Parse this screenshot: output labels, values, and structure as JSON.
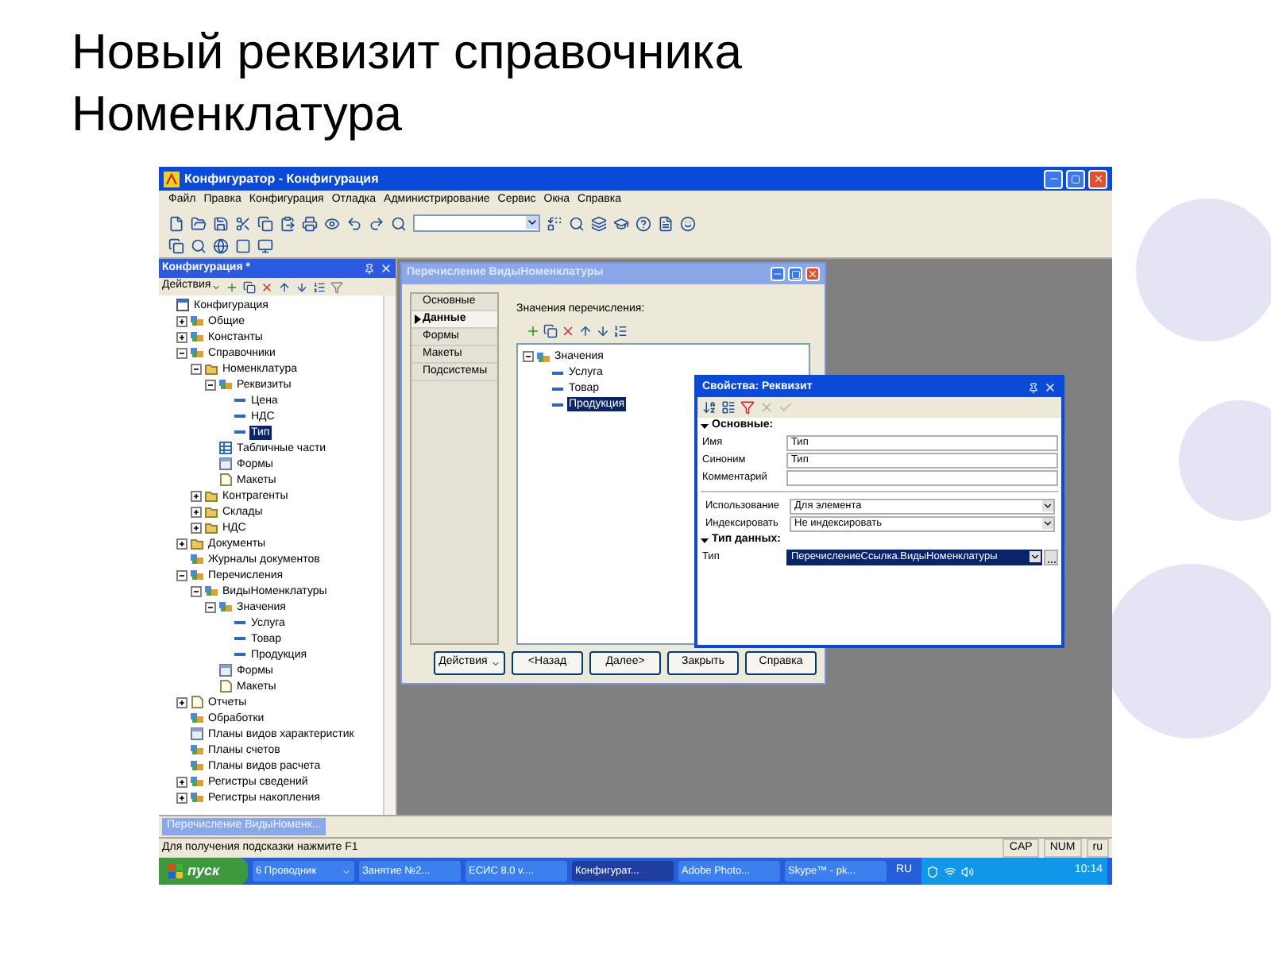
{
  "slide_title": "Новый реквизит справочника Номенклатура",
  "app": {
    "title": "Конфигуратор - Конфигурация",
    "menu": [
      "Файл",
      "Правка",
      "Конфигурация",
      "Отладка",
      "Администрирование",
      "Сервис",
      "Окна",
      "Справка"
    ],
    "config_panel": {
      "title": "Конфигурация *",
      "actions_label": "Действия",
      "tree": [
        {
          "label": "Конфигурация",
          "kind": "root",
          "selected": false,
          "children": [
            {
              "label": "Общие",
              "kind": "group",
              "expanded": false,
              "selected": false
            },
            {
              "label": "Константы",
              "kind": "group",
              "expanded": false,
              "selected": false
            },
            {
              "label": "Справочники",
              "kind": "group",
              "expanded": true,
              "selected": false,
              "children": [
                {
                  "label": "Номенклатура",
                  "kind": "folder",
                  "expanded": true,
                  "selected": false,
                  "children": [
                    {
                      "label": "Реквизиты",
                      "kind": "group",
                      "expanded": true,
                      "selected": false,
                      "children": [
                        {
                          "label": "Цена",
                          "kind": "item",
                          "selected": false
                        },
                        {
                          "label": "НДС",
                          "kind": "item",
                          "selected": false
                        },
                        {
                          "label": "Тип",
                          "kind": "item",
                          "selected": true
                        }
                      ]
                    },
                    {
                      "label": "Табличные части",
                      "kind": "table",
                      "selected": false
                    },
                    {
                      "label": "Формы",
                      "kind": "form",
                      "selected": false
                    },
                    {
                      "label": "Макеты",
                      "kind": "layout",
                      "selected": false
                    }
                  ]
                },
                {
                  "label": "Контрагенты",
                  "kind": "folder",
                  "expanded": false,
                  "selected": false
                },
                {
                  "label": "Склады",
                  "kind": "folder",
                  "expanded": false,
                  "selected": false
                },
                {
                  "label": "НДС",
                  "kind": "folder",
                  "expanded": false,
                  "selected": false
                }
              ]
            },
            {
              "label": "Документы",
              "kind": "folder",
              "expanded": false,
              "selected": false
            },
            {
              "label": "Журналы документов",
              "kind": "group",
              "selected": false
            },
            {
              "label": "Перечисления",
              "kind": "group",
              "expanded": true,
              "selected": false,
              "children": [
                {
                  "label": "ВидыНоменклатуры",
                  "kind": "group",
                  "expanded": true,
                  "selected": false,
                  "children": [
                    {
                      "label": "Значения",
                      "kind": "group",
                      "expanded": true,
                      "selected": false,
                      "children": [
                        {
                          "label": "Услуга",
                          "kind": "item",
                          "selected": false
                        },
                        {
                          "label": "Товар",
                          "kind": "item",
                          "selected": false
                        },
                        {
                          "label": "Продукция",
                          "kind": "item",
                          "selected": false
                        }
                      ]
                    },
                    {
                      "label": "Формы",
                      "kind": "form",
                      "selected": false
                    },
                    {
                      "label": "Макеты",
                      "kind": "layout",
                      "selected": false
                    }
                  ]
                }
              ]
            },
            {
              "label": "Отчеты",
              "kind": "layout",
              "expanded": false,
              "selected": false
            },
            {
              "label": "Обработки",
              "kind": "group",
              "selected": false
            },
            {
              "label": "Планы видов характеристик",
              "kind": "form",
              "selected": false
            },
            {
              "label": "Планы счетов",
              "kind": "group",
              "selected": false
            },
            {
              "label": "Планы видов расчета",
              "kind": "group",
              "selected": false
            },
            {
              "label": "Регистры сведений",
              "kind": "group",
              "expanded": false,
              "selected": false
            },
            {
              "label": "Регистры накопления",
              "kind": "group",
              "expanded": false,
              "selected": false
            }
          ]
        }
      ]
    },
    "enum_window": {
      "title": "Перечисление ВидыНоменклатуры",
      "active": false,
      "tabs": [
        {
          "label": "Основные",
          "selected": false
        },
        {
          "label": "Данные",
          "selected": true
        },
        {
          "label": "Формы",
          "selected": false
        },
        {
          "label": "Макеты",
          "selected": false
        },
        {
          "label": "Подсистемы",
          "selected": false
        }
      ],
      "values_label": "Значения перечисления:",
      "tree": [
        {
          "label": "Значения",
          "kind": "group",
          "expanded": true,
          "selected": false,
          "children": [
            {
              "label": "Услуга",
              "kind": "item",
              "selected": false
            },
            {
              "label": "Товар",
              "kind": "item",
              "selected": false
            },
            {
              "label": "Продукция",
              "kind": "item",
              "selected": true
            }
          ]
        }
      ],
      "buttons": [
        {
          "label": "Действия",
          "kind": "menu"
        },
        {
          "label": "<Назад",
          "kind": "plain"
        },
        {
          "label": "Далее>",
          "kind": "plain"
        },
        {
          "label": "Закрыть",
          "kind": "plain"
        },
        {
          "label": "Справка",
          "kind": "plain"
        }
      ]
    },
    "properties_window": {
      "title": "Свойства: Реквизит",
      "active": true,
      "sections": [
        {
          "title": "Основные:",
          "expanded": true,
          "groups": [
            [
              {
                "label": "Имя",
                "kind": "text",
                "value": "Тип"
              },
              {
                "label": "Синоним",
                "kind": "text",
                "value": "Тип"
              },
              {
                "label": "Комментарий",
                "kind": "text"
              }
            ],
            [
              {
                "label": "Использование",
                "kind": "select",
                "value": "Для элемента"
              },
              {
                "label": "Индексировать",
                "kind": "select",
                "value": "Не индексировать"
              }
            ]
          ]
        },
        {
          "title": "Тип данных:",
          "expanded": true,
          "groups": [
            [
              {
                "label": "Тип",
                "kind": "type",
                "value": "ПеречислениеСсылка.ВидыНоменклатуры",
                "selected": true
              }
            ]
          ]
        }
      ]
    },
    "window_tabs": [
      {
        "label": "Перечисление ВидыНоменк...",
        "selected": true
      }
    ],
    "status_bar": {
      "hint": "Для получения подсказки нажмите F1",
      "indicators": [
        "CAP",
        "NUM",
        "ru"
      ]
    },
    "taskbar": {
      "start": "пуск",
      "tasks": [
        {
          "label": "6 Проводник",
          "selected": false,
          "grouped": true
        },
        {
          "label": "Занятие №2...",
          "selected": false,
          "grouped": false
        },
        {
          "label": "ЕСИС 8.0 v....",
          "selected": false,
          "grouped": false
        },
        {
          "label": "Конфигурат...",
          "selected": true,
          "grouped": false
        },
        {
          "label": "Adobe Photo...",
          "selected": false,
          "grouped": false
        },
        {
          "label": "Skype™ - pk...",
          "selected": false,
          "grouped": false
        }
      ],
      "language": "RU",
      "clock": "10:14"
    }
  }
}
